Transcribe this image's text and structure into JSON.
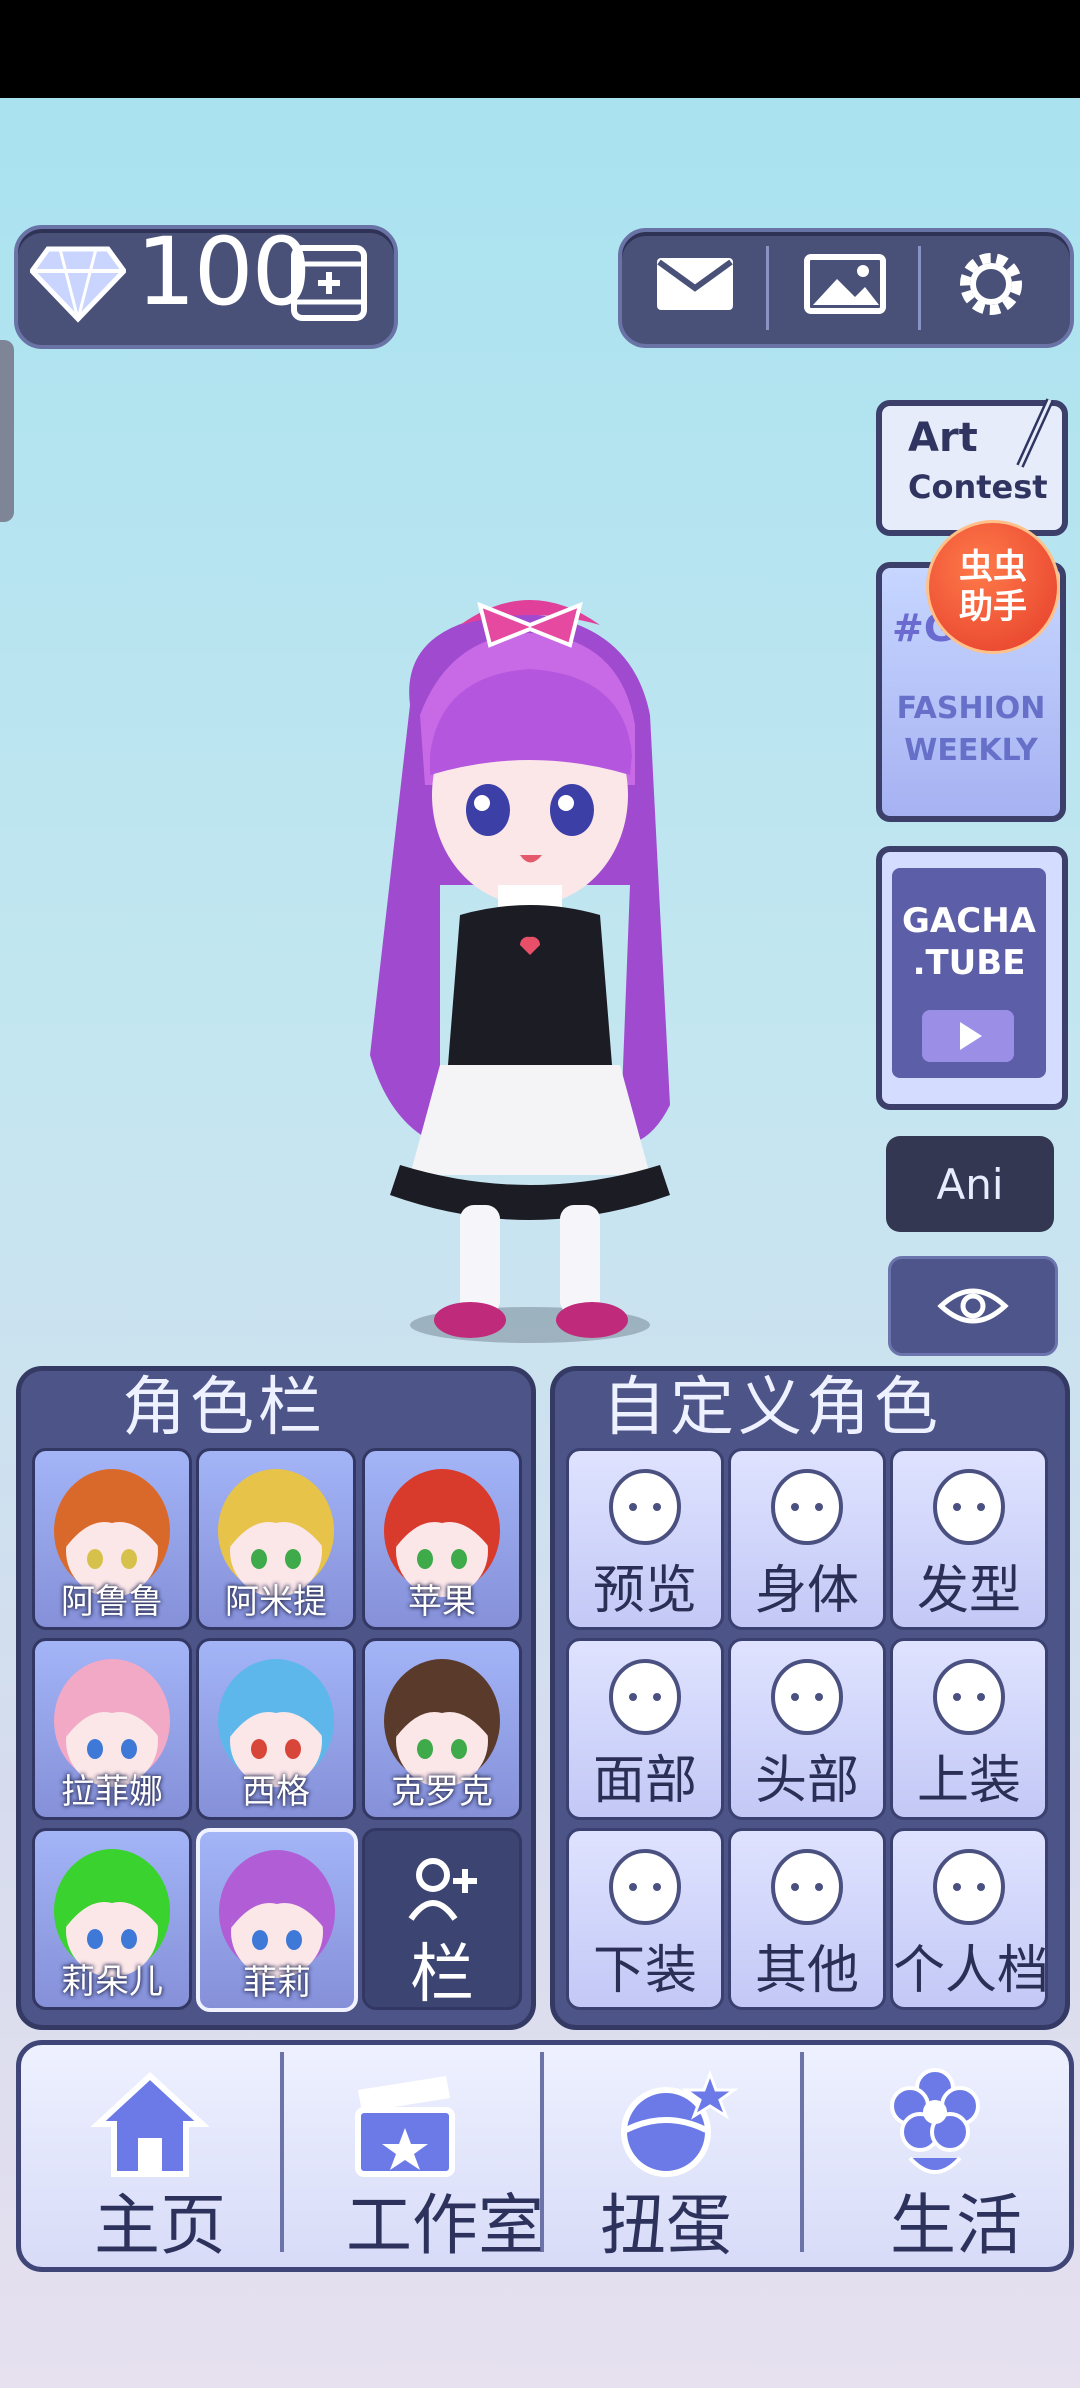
{
  "currency": {
    "count": "100",
    "icon": "diamond-icon",
    "add_icon": "film-plus-icon"
  },
  "top_buttons": [
    {
      "name": "mail-icon"
    },
    {
      "name": "gallery-icon"
    },
    {
      "name": "settings-icon"
    }
  ],
  "side": {
    "art_contest": {
      "line1": "Art",
      "line2": "Contest"
    },
    "fashion": {
      "tag": "#GC2",
      "line1": "FASHION",
      "line2": "WEEKLY"
    },
    "badge": {
      "line1": "虫虫",
      "line2": "助手"
    },
    "gacha": {
      "line1": "GACHA",
      ".line2": ".TUBE",
      "line2_text": ".TUBE"
    },
    "ani_label": "Ani"
  },
  "char_panel": {
    "title": "角色栏",
    "slots": [
      {
        "label": "阿鲁鲁",
        "hair": "#d9692a",
        "eye": "#d6c24a"
      },
      {
        "label": "阿米提",
        "hair": "#e8c34a",
        "eye": "#3faa4a"
      },
      {
        "label": "苹果",
        "hair": "#d83a2c",
        "eye": "#3faa4a"
      },
      {
        "label": "拉菲娜",
        "hair": "#f2a9c6",
        "eye": "#3e79d8"
      },
      {
        "label": "西格",
        "hair": "#5db7ea",
        "eye": "#d8463a"
      },
      {
        "label": "克罗克",
        "hair": "#5a3a2a",
        "eye": "#3faa4a"
      },
      {
        "label": "莉朵儿",
        "hair": "#39d22e",
        "eye": "#3e79d8"
      },
      {
        "label": "菲莉",
        "hair": "#b15ed6",
        "eye": "#3e79d8"
      }
    ],
    "add_label": "栏"
  },
  "custom_panel": {
    "title": "自定义角色",
    "items": [
      {
        "label": "预览"
      },
      {
        "label": "身体"
      },
      {
        "label": "发型"
      },
      {
        "label": "面部"
      },
      {
        "label": "头部"
      },
      {
        "label": "上装"
      },
      {
        "label": "下装"
      },
      {
        "label": "其他"
      },
      {
        "label": "个人档"
      }
    ]
  },
  "bottom_nav": [
    {
      "label": "主页"
    },
    {
      "label": "工作室"
    },
    {
      "label": "扭蛋"
    },
    {
      "label": "生活"
    }
  ]
}
